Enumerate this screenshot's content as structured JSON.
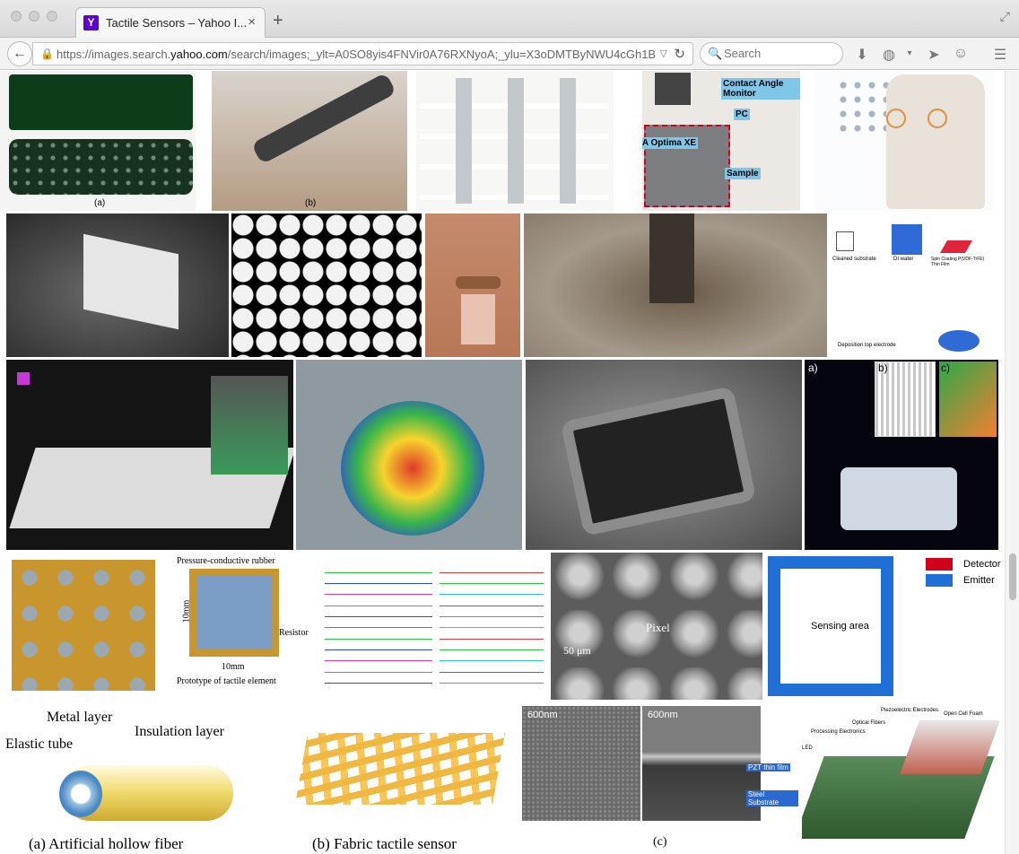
{
  "browser": {
    "tab_title": "Tactile Sensors – Yahoo I...",
    "tab_favicon": "Y",
    "tab_close": "×",
    "new_tab": "+",
    "url_prefix": "https://images.search.",
    "url_domain": "yahoo.com",
    "url_path": "/search/images;_ylt=A0SO8yis4FNVir0A76RXNyoA;_ylu=X3oDMTByNWU4cGh1B",
    "search_placeholder": "Search",
    "icons": [
      "lock-icon",
      "back-icon",
      "reload-icon",
      "search-icon",
      "download-icon",
      "globe-icon",
      "send-icon",
      "chat-icon",
      "menu-icon"
    ]
  },
  "thumbs": {
    "t1": {
      "labels": [
        "(a)",
        "(b)"
      ]
    },
    "t3": {
      "labels": []
    },
    "t4": {
      "labels": [
        "Contact Angle Monitor",
        "PC",
        "VCA Optima XE",
        "Sample"
      ]
    },
    "t10": {
      "labels": [
        "Cleaned substrate",
        "DI water",
        "Spin Coating P(VDF-TrFE) Thin Film",
        "Deposition top electrode"
      ]
    },
    "t14": {
      "labels": [
        "a)",
        "b)",
        "c)"
      ]
    },
    "t15": {
      "labels": [
        "Pressure-conductive rubber",
        "10mm",
        "Resistor",
        "10mm",
        "Prototype of tactile element"
      ]
    },
    "t17": {
      "labels": [
        "Pixel",
        "50 μm"
      ]
    },
    "t18": {
      "legend": [
        "Detector",
        "Emitter"
      ],
      "center": "Sensing area",
      "colors": {
        "detector": "#d0021b",
        "emitter": "#1f6fd6"
      }
    },
    "t19": {
      "labels": [
        "Metal layer",
        "Elastic tube",
        "Insulation layer",
        "(a) Artificial hollow fiber"
      ]
    },
    "t20": {
      "labels": [
        "(b) Fabric tactile sensor"
      ]
    },
    "t21": {
      "labels": [
        "600nm",
        "600nm",
        "PZT thin film",
        "Steel Substrate",
        "(c)"
      ]
    },
    "t22": {
      "labels": [
        "Piezoelectric Electrodes",
        "Open Cell Foam",
        "Optical Fibers",
        "Processing Electronics",
        "LED"
      ]
    }
  }
}
